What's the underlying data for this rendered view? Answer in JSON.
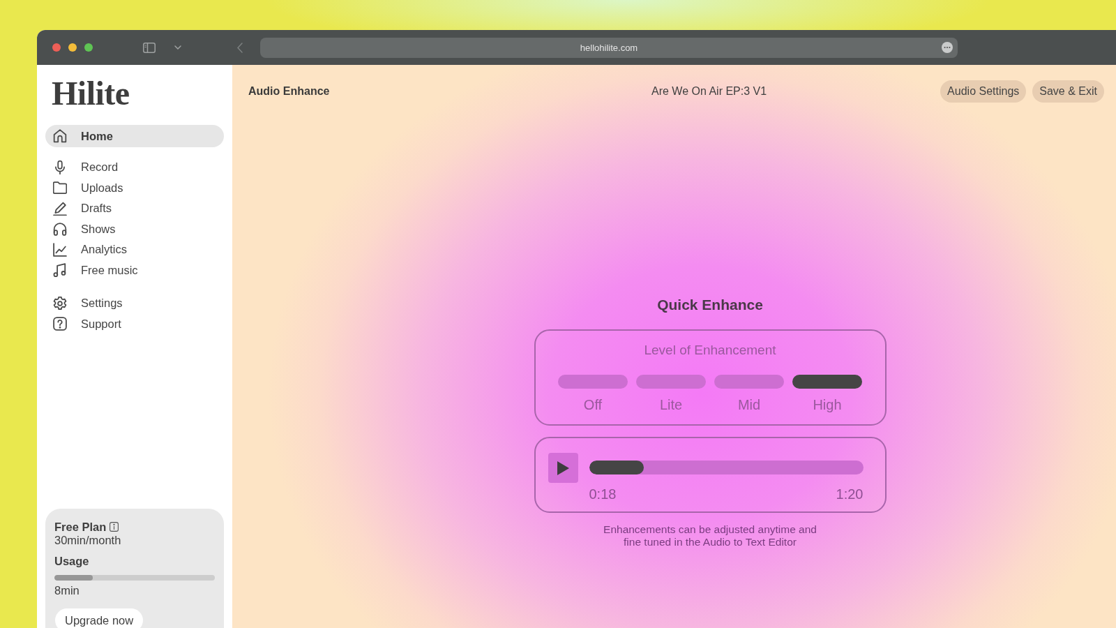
{
  "browser": {
    "url": "hellohilite.com"
  },
  "sidebar": {
    "logo": "Hilite",
    "items": [
      {
        "label": "Home",
        "selected": true
      },
      {
        "label": "Record",
        "selected": false
      },
      {
        "label": "Uploads",
        "selected": false
      },
      {
        "label": "Drafts",
        "selected": false
      },
      {
        "label": "Shows",
        "selected": false
      },
      {
        "label": "Analytics",
        "selected": false
      },
      {
        "label": "Free music",
        "selected": false
      }
    ],
    "footer_items": [
      {
        "label": "Settings",
        "selected": false
      },
      {
        "label": "Support",
        "selected": false
      }
    ],
    "plan": {
      "name": "Free Plan",
      "allowance": "30min/month",
      "usage_label": "Usage",
      "usage": {
        "level": 0.24
      },
      "used": "8min",
      "upgrade_button": "Upgrade now"
    }
  },
  "header": {
    "title": "Audio Enhance",
    "project": "Are We On Air EP:3 V1",
    "buttons": [
      "Audio Settings",
      "Save & Exit"
    ]
  },
  "quick_enhance": {
    "title": "Quick Enhance",
    "level_title": "Level of Enhancement",
    "levels": [
      {
        "label": "Off",
        "selected": false
      },
      {
        "label": "Lite",
        "selected": false
      },
      {
        "label": "Mid",
        "selected": false
      },
      {
        "label": "High",
        "selected": true
      }
    ],
    "player": {
      "progress": {
        "level": 0.2
      },
      "elapsed": "0:18",
      "duration": "1:20"
    },
    "note": "Enhancements can be adjusted anytime and fine tuned in the Audio to Text Editor"
  }
}
